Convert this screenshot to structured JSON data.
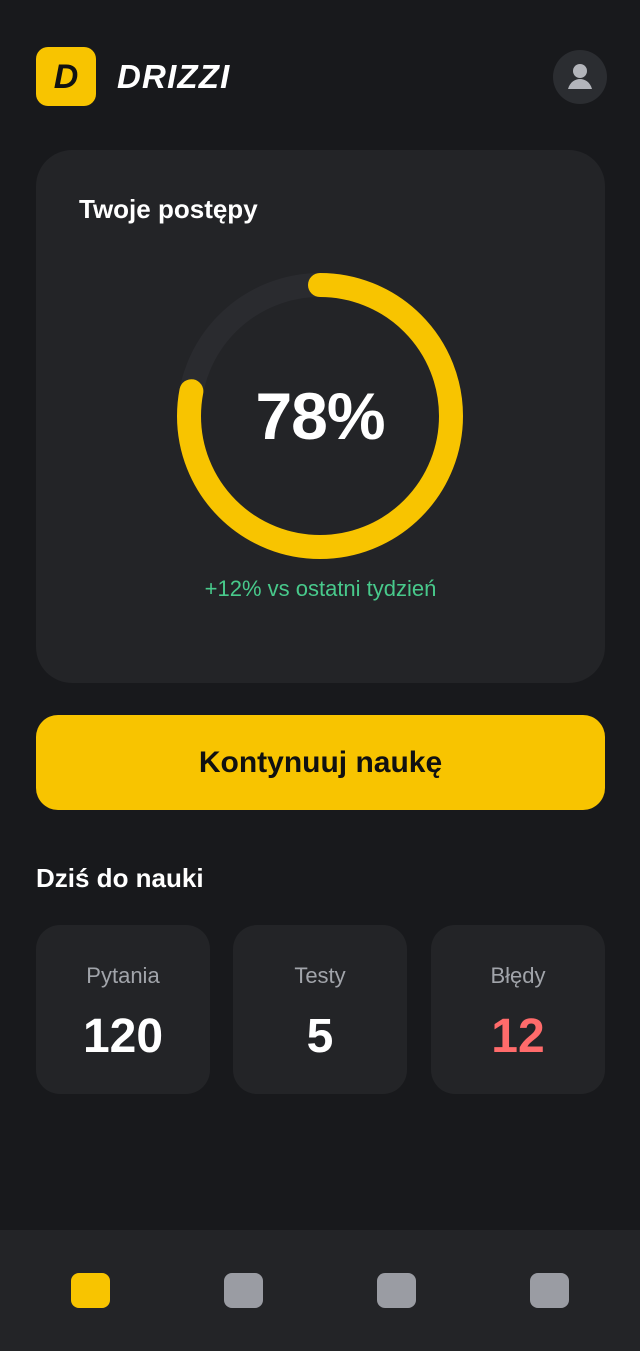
{
  "app": {
    "logo_letter": "D",
    "name": "DRIZZI"
  },
  "header": {
    "avatar_icon": "user-avatar-icon"
  },
  "progress": {
    "title": "Twoje postępy",
    "percent_label": "78%",
    "fraction": 0.78,
    "delta_label": "+12% vs ostatni tydzień",
    "ring_color": "#f8c400",
    "track_color": "#2a2b2f",
    "delta_color": "#48c98b"
  },
  "actions": {
    "continue_label": "Kontynuuj naukę"
  },
  "today": {
    "title": "Dziś do nauki",
    "stats": [
      {
        "label": "Pytania",
        "value": "120"
      },
      {
        "label": "Testy",
        "value": "5"
      },
      {
        "label": "Błędy",
        "value": "12",
        "value_color": "#ff6b6b"
      }
    ]
  },
  "bottom_nav": {
    "items": [
      {
        "icon": "nav-home-icon",
        "active": true
      },
      {
        "icon": "nav-tab-2-icon",
        "active": false
      },
      {
        "icon": "nav-tab-3-icon",
        "active": false
      },
      {
        "icon": "nav-tab-4-icon",
        "active": false
      }
    ]
  },
  "colors": {
    "background": "#18191c",
    "card": "#232427",
    "accent": "#f8c400",
    "muted_text": "#a1a4aa"
  }
}
